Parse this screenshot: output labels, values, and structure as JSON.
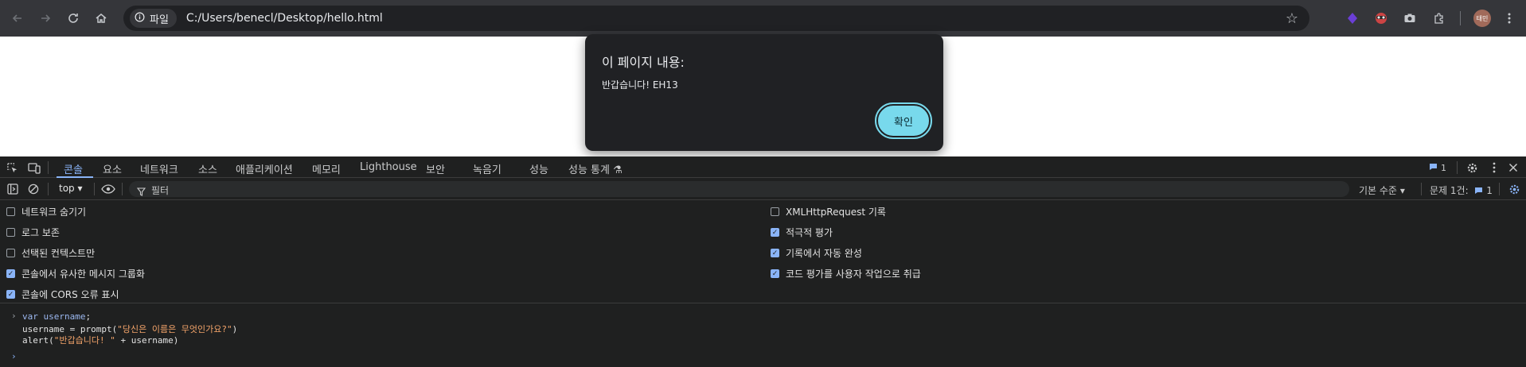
{
  "browser": {
    "site_info_label": "파일",
    "url": "C:/Users/benecl/Desktop/hello.html",
    "profile_initials": "태민"
  },
  "dialog": {
    "title": "이 페이지 내용:",
    "message": "반갑습니다! EH13",
    "ok_label": "확인"
  },
  "devtools": {
    "tabs": [
      "콘솔",
      "요소",
      "네트워크",
      "소스",
      "애플리케이션",
      "메모리",
      "Lighthouse",
      "보안",
      "녹음기",
      "성능",
      "성능 통계 ⚗"
    ],
    "active_tab": "콘솔",
    "issue_badge_count": "1",
    "toolbar": {
      "context": "top",
      "filter_placeholder": "필터",
      "levels_label": "기본 수준",
      "issues_label": "문제 1건:",
      "issues_count": "1"
    },
    "settings_left": [
      {
        "label": "네트워크 숨기기",
        "checked": false
      },
      {
        "label": "로그 보존",
        "checked": false
      },
      {
        "label": "선택된 컨텍스트만",
        "checked": false
      },
      {
        "label": "콘솔에서 유사한 메시지 그룹화",
        "checked": true
      },
      {
        "label": "콘솔에 CORS 오류 표시",
        "checked": true
      }
    ],
    "settings_right": [
      {
        "label": "XMLHttpRequest 기록",
        "checked": false
      },
      {
        "label": "적극적 평가",
        "checked": true
      },
      {
        "label": "기록에서 자동 완성",
        "checked": true
      },
      {
        "label": "코드 평가를 사용자 작업으로 취급",
        "checked": true
      }
    ],
    "console": {
      "line1_kw": "var",
      "line1_var": "username",
      "line1_end": ";",
      "line2_pre": "username = prompt(",
      "line2_str": "\"당신은 이름은 무엇인가요?\"",
      "line2_end": ")",
      "line3_pre": "alert(",
      "line3_str": "\"반갑습니다! \"",
      "line3_end": " + username)"
    }
  },
  "colors": {
    "accent": "#8ab4f8",
    "dialog_button": "#78d9ec"
  }
}
